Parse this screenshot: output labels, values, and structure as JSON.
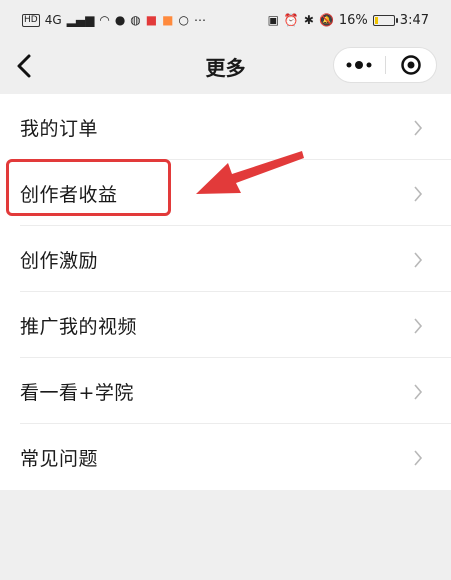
{
  "status_bar": {
    "left_badge": "HD",
    "network": "4G",
    "battery_text": "16%",
    "battery_level": 0.16,
    "time": "3:47"
  },
  "nav": {
    "title": "更多",
    "back_icon": "chevron-left-icon",
    "more_icon": "dots-icon",
    "close_icon": "target-icon"
  },
  "menu": {
    "items": [
      {
        "label": "我的订单"
      },
      {
        "label": "创作者收益"
      },
      {
        "label": "创作激励"
      },
      {
        "label": "推广我的视频"
      },
      {
        "label": "看一看+学院"
      },
      {
        "label": "常见问题"
      }
    ]
  },
  "annotation": {
    "highlight_color": "#e23a3a",
    "arrow_color": "#e23a3a"
  }
}
